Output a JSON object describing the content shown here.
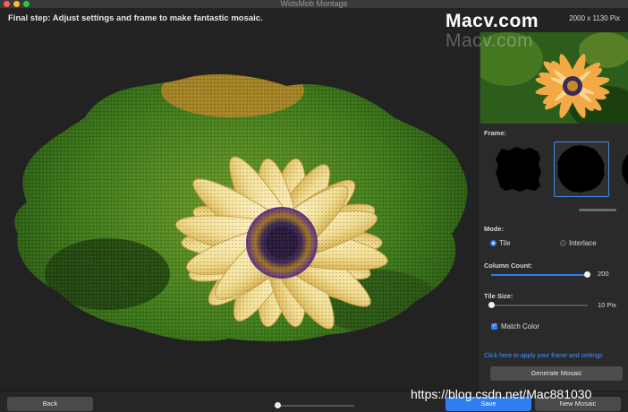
{
  "window": {
    "title": "WidsMob Montage"
  },
  "header": {
    "step_text": "Final step: Adjust settings and frame to make fantastic mosaic.",
    "dimensions": "2000 x 1130 Pix"
  },
  "watermark": {
    "line1": "Macv.com",
    "line2": "Macv.com",
    "url": "https://blog.csdn.net/Mac881030"
  },
  "panel": {
    "frame_label": "Frame:",
    "frames": [
      {
        "name": "rough-square",
        "selected": false
      },
      {
        "name": "circle",
        "selected": true
      },
      {
        "name": "partial",
        "selected": false
      }
    ],
    "mode_label": "Mode:",
    "mode_options": [
      {
        "label": "Tile",
        "selected": true
      },
      {
        "label": "Interlace",
        "selected": false
      }
    ],
    "column_count_label": "Column Count:",
    "column_count_value": "200",
    "column_count_level": 0.99,
    "tile_size_label": "Tile Size:",
    "tile_size_value": "10 Pix",
    "tile_size_level": 0.0,
    "match_color_label": "Match Color",
    "match_color_checked": true,
    "apply_link": "Click here to apply your frame and settings",
    "generate_label": "Generate Mosaic"
  },
  "footer": {
    "back_label": "Back",
    "save_label": "Save",
    "new_mosaic_label": "New Mosaic",
    "zoom_level": 0.0
  },
  "colors": {
    "accent": "#2f7ff1",
    "link": "#3d95ff",
    "background": "#232323",
    "panel": "#2a2a2a"
  }
}
